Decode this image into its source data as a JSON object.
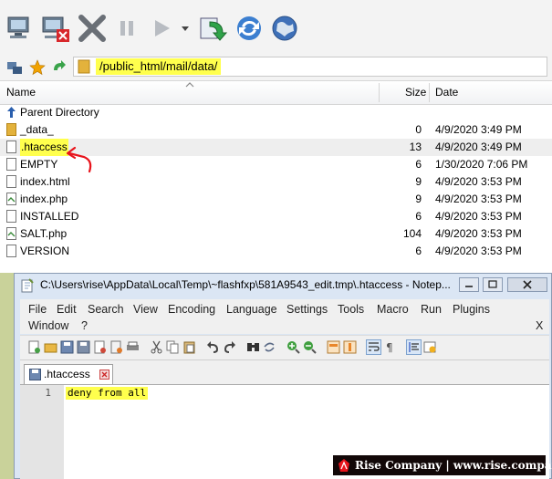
{
  "path": "/public_html/mail/data/",
  "columns": {
    "name": "Name",
    "size": "Size",
    "date": "Date"
  },
  "files": [
    {
      "name": "Parent Directory",
      "size": "",
      "date": "",
      "icon": "up-arrow-icon"
    },
    {
      "name": "_data_",
      "size": "0",
      "date": "4/9/2020 3:49 PM",
      "icon": "folder-icon"
    },
    {
      "name": ".htaccess",
      "size": "13",
      "date": "4/9/2020 3:49 PM",
      "icon": "file-icon"
    },
    {
      "name": "EMPTY",
      "size": "6",
      "date": "1/30/2020 7:06 PM",
      "icon": "file-icon"
    },
    {
      "name": "index.html",
      "size": "9",
      "date": "4/9/2020 3:53 PM",
      "icon": "file-icon"
    },
    {
      "name": "index.php",
      "size": "9",
      "date": "4/9/2020 3:53 PM",
      "icon": "php-file-icon"
    },
    {
      "name": "INSTALLED",
      "size": "6",
      "date": "4/9/2020 3:53 PM",
      "icon": "file-icon"
    },
    {
      "name": "SALT.php",
      "size": "104",
      "date": "4/9/2020 3:53 PM",
      "icon": "php-file-icon"
    },
    {
      "name": "VERSION",
      "size": "6",
      "date": "4/9/2020 3:53 PM",
      "icon": "file-icon"
    }
  ],
  "notepad": {
    "title": "C:\\Users\\rise\\AppData\\Local\\Temp\\~flashfxp\\581A9543_edit.tmp\\.htaccess - Notep...",
    "menu": [
      "File",
      "Edit",
      "Search",
      "View",
      "Encoding",
      "Language",
      "Settings",
      "Tools",
      "Macro",
      "Run",
      "Plugins",
      "Window",
      "?"
    ],
    "close_menu": "X",
    "tab": ".htaccess",
    "line_number": "1",
    "code": "deny from all"
  },
  "watermark": "Rise Company | www.rise.company",
  "colors": {
    "highlight": "#ffff4d",
    "annotation": "#e8141c",
    "watermark_bg": "#120808"
  }
}
